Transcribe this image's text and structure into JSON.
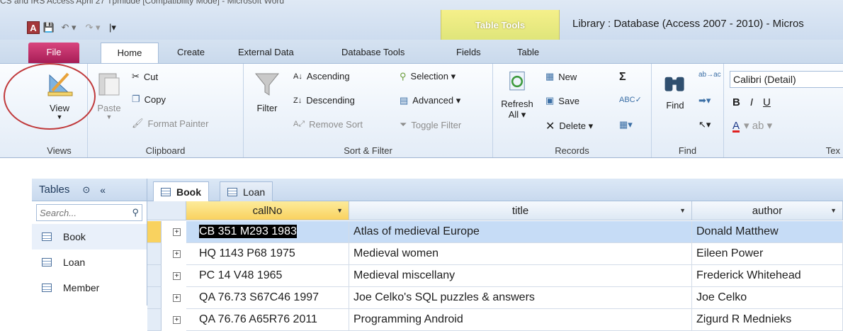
{
  "window": {
    "top_text": "CS and IRS Access April 27 Tpmidde [Compatibility Mode] - Microsoft Word",
    "title": "Library : Database (Access 2007 - 2010)  -  Micros",
    "context_tab_group": "Table Tools"
  },
  "qat": {
    "app_icon_letter": "A",
    "save_glyph": "💾",
    "undo_glyph": "↶ ▾",
    "redo_glyph": "↷ ▾",
    "customize_glyph": "|▾"
  },
  "tabs": [
    "File",
    "Home",
    "Create",
    "External Data",
    "Database Tools",
    "Fields",
    "Table"
  ],
  "ribbon": {
    "views": {
      "view_label": "View",
      "group": "Views"
    },
    "clipboard": {
      "paste_label": "Paste",
      "cut": "Cut",
      "copy": "Copy",
      "format_painter": "Format Painter",
      "group": "Clipboard"
    },
    "sort_filter": {
      "filter": "Filter",
      "ascending": "Ascending",
      "descending": "Descending",
      "remove_sort": "Remove Sort",
      "selection": "Selection ▾",
      "advanced": "Advanced ▾",
      "toggle_filter": "Toggle Filter",
      "group": "Sort & Filter"
    },
    "records": {
      "refresh": "Refresh",
      "refresh_sub": "All ▾",
      "new": "New",
      "save": "Save",
      "delete": "Delete ▾",
      "group": "Records"
    },
    "find": {
      "find": "Find",
      "group": "Find"
    },
    "text_formatting": {
      "font": "Calibri (Detail)",
      "bold": "B",
      "italic": "I",
      "underline": "U",
      "group": "Tex"
    }
  },
  "nav": {
    "header": "Tables",
    "search_placeholder": "Search...",
    "items": [
      "Book",
      "Loan",
      "Member"
    ]
  },
  "doc_tabs": [
    "Book",
    "Loan"
  ],
  "table": {
    "columns": [
      "callNo",
      "title",
      "author"
    ],
    "rows": [
      [
        "CB 351 M293 1983",
        "Atlas of medieval Europe",
        "Donald Matthew"
      ],
      [
        "HQ 1143 P68 1975",
        "Medieval women",
        "Eileen Power"
      ],
      [
        "PC 14 V48 1965",
        "Medieval miscellany",
        "Frederick Whitehead"
      ],
      [
        "QA 76.73 S67C46 1997",
        "Joe Celko's SQL puzzles & answers",
        "Joe Celko"
      ],
      [
        "QA 76.76 A65R76 2011",
        "Programming Android",
        "Zigurd R Mednieks"
      ]
    ]
  },
  "colors": {
    "file_tab": "#b62860",
    "table_tools": "#e9ea7f",
    "annotation_circle": "#c0393b",
    "selected_row": "#c6dcf6"
  }
}
